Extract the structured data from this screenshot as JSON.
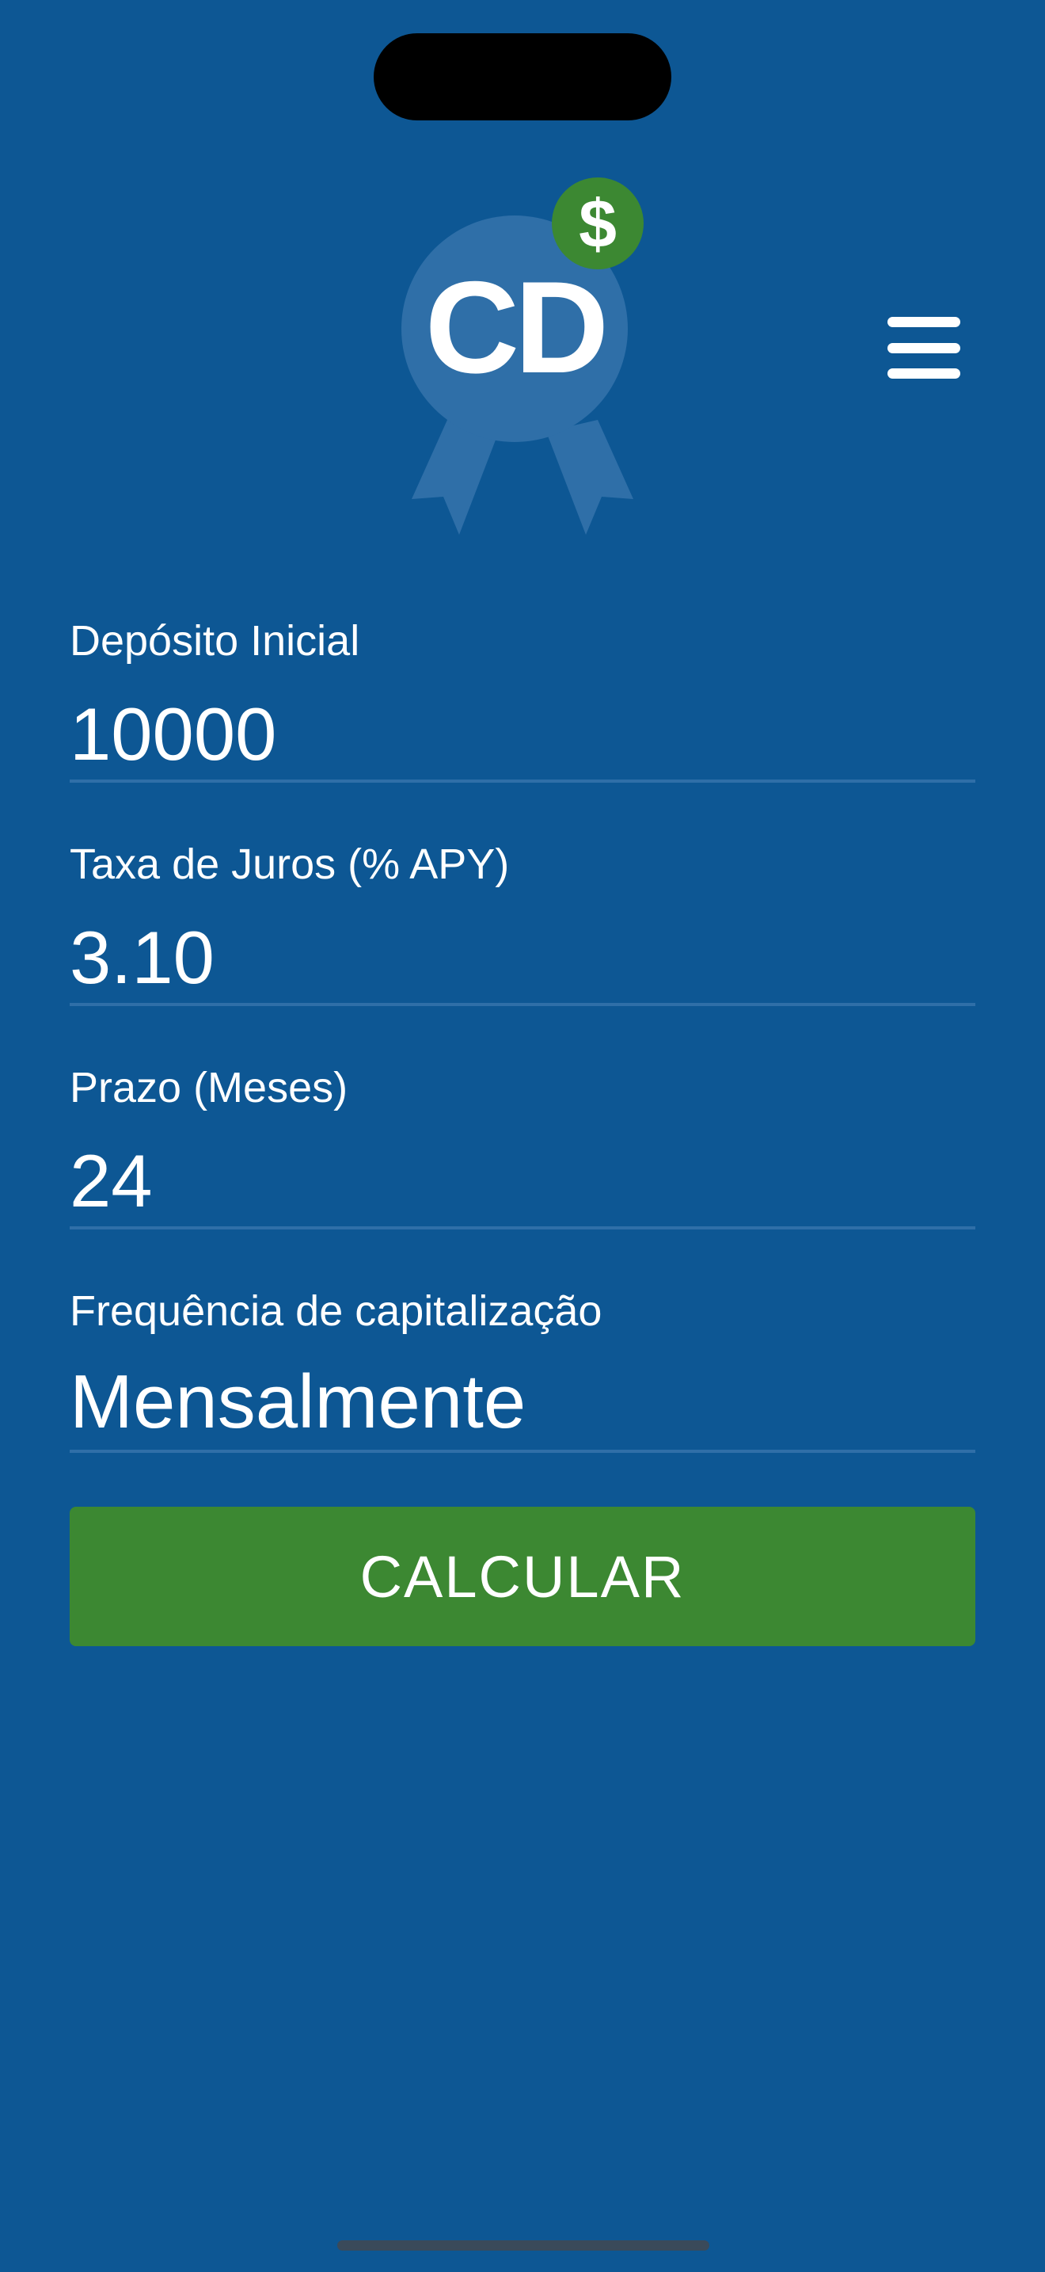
{
  "app": {
    "logo_text": "CD",
    "logo_badge_symbol": "$",
    "logo_icon": "cd-award-ribbon-icon",
    "menu_icon": "hamburger-menu-icon"
  },
  "form": {
    "deposit": {
      "label": "Depósito Inicial",
      "value": "10000"
    },
    "rate": {
      "label": "Taxa de Juros (% APY)",
      "value": "3.10"
    },
    "term": {
      "label": "Prazo (Meses)",
      "value": "24"
    },
    "frequency": {
      "label": "Frequência de capitalização",
      "value": "Mensalmente"
    }
  },
  "actions": {
    "calculate_label": "CALCULAR"
  },
  "colors": {
    "background": "#0d5794",
    "button": "#3c8832",
    "badge": "#3c8832",
    "logo_circle": "#2f6fa8",
    "underline": "#2f6fa8"
  }
}
